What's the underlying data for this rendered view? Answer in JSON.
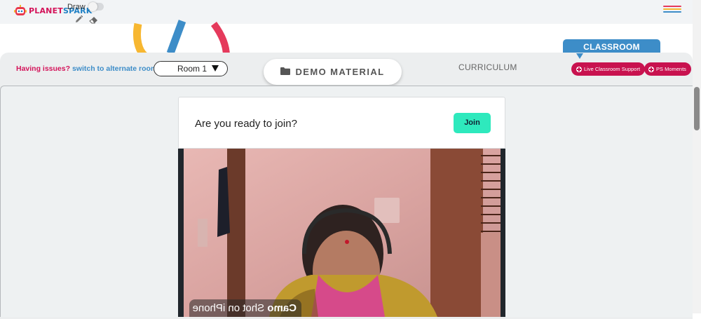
{
  "header": {
    "logo_text_part1": "PLANET",
    "logo_text_part2": "SPARK",
    "draw_label": "Draw",
    "draw_toggle_on": false,
    "icons": [
      "pencil-icon",
      "eraser-icon",
      "hamburger-icon"
    ],
    "menu_stripe_colors": [
      "#e53a5c",
      "#f7b731",
      "#3d8dc8"
    ]
  },
  "toolbar": {
    "issues_text": "Having issues?",
    "switch_link": "switch to alternate room",
    "room_selected": "Room 1",
    "demo_material_label": "DEMO MATERIAL",
    "curriculum_label": "CURRICULUM",
    "classroom_label": "CLASSROOM",
    "live_support_label": "Live Classroom Support",
    "ps_moments_label": "PS Moments"
  },
  "join": {
    "prompt": "Are you ready to join?",
    "join_label": "Join"
  },
  "video": {
    "watermark_brand": "Camo",
    "watermark_text": "Shot on iPhone"
  },
  "colors": {
    "brand_pink": "#d4145a",
    "brand_blue": "#3d8dc8",
    "join_green": "#2ee9bd",
    "support_red": "#c8124f"
  }
}
